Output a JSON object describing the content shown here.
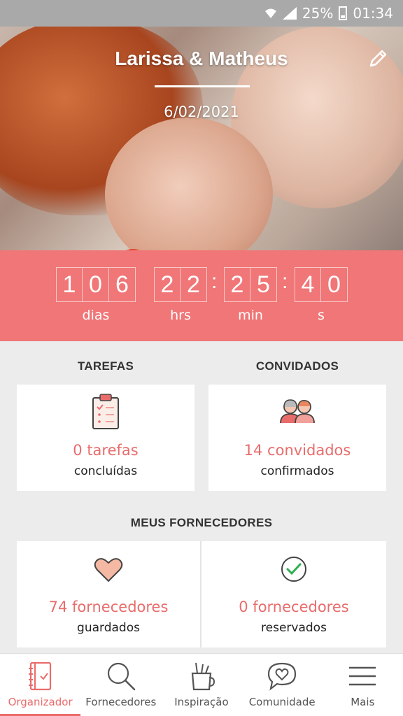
{
  "status_bar": {
    "battery": "25%",
    "time": "01:34"
  },
  "hero": {
    "couple_name": "Larissa & Matheus",
    "date": "6/02/2021"
  },
  "countdown": {
    "days_digits": [
      "1",
      "0",
      "6"
    ],
    "hours_digits": [
      "2",
      "2"
    ],
    "minutes_digits": [
      "2",
      "5"
    ],
    "seconds_digits": [
      "4",
      "0"
    ],
    "separator": ":",
    "labels": {
      "days": "dias",
      "hours": "hrs",
      "minutes": "min",
      "seconds": "s"
    }
  },
  "tasks": {
    "title": "TAREFAS",
    "value": "0 tarefas",
    "sub": "concluídas"
  },
  "guests": {
    "title": "CONVIDADOS",
    "value": "14 convidados",
    "sub": "confirmados"
  },
  "vendors": {
    "title": "MEUS FORNECEDORES",
    "saved": {
      "value": "74 fornecedores",
      "sub": "guardados"
    },
    "booked": {
      "value": "0 fornecedores",
      "sub": "reservados"
    }
  },
  "nav": {
    "items": [
      {
        "label": "Organizador",
        "icon": "notebook-icon"
      },
      {
        "label": "Fornecedores",
        "icon": "search-icon"
      },
      {
        "label": "Inspiração",
        "icon": "supplies-icon"
      },
      {
        "label": "Comunidade",
        "icon": "chat-heart-icon"
      },
      {
        "label": "Mais",
        "icon": "menu-icon"
      }
    ],
    "active_index": 0
  },
  "colors": {
    "accent": "#f07677",
    "accent_text": "#e96c6b",
    "background": "#ececec"
  }
}
